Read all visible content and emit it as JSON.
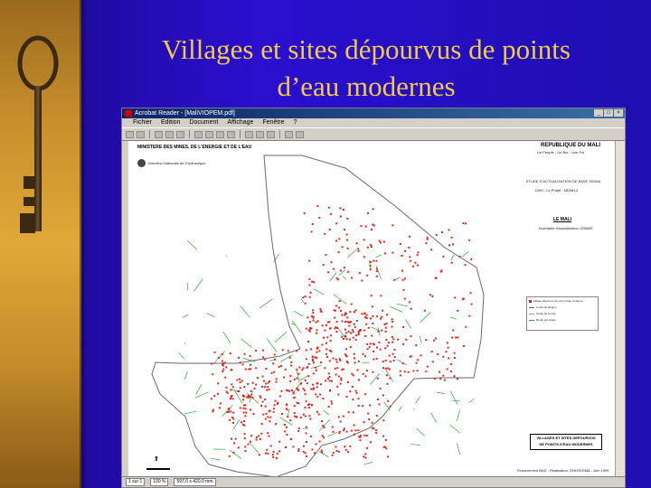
{
  "slide": {
    "title_line1": "Villages et sites dépourvus de points",
    "title_line2": "d’eau modernes"
  },
  "window": {
    "title": "Acrobat Reader - [MaliVIOPEM.pdf]",
    "controls": [
      "_",
      "□",
      "×"
    ]
  },
  "menu": [
    "Fichier",
    "Edition",
    "Document",
    "Affichage",
    "Fenêtre",
    "?"
  ],
  "map": {
    "ministry": "MINISTERE DES MINES, DE L'ENERGIE ET DE L'EAU",
    "direction": "Direction Nationale de l'Hydraulique",
    "republic": "REPUBLIQUE DU MALI",
    "motto": "Un Peuple - Un But - Une Foi",
    "study": "ETUDE D'ACTUALISATION DE BASE SIGMA",
    "project": "DNH - Le Projet - MDNH-2",
    "map_label": "LE MALI",
    "inventory": "Inventaire d'actualisation 1998/99",
    "legend": [
      "Village dépourvu de point d'eau moderne",
      "Limite de Région",
      "Limite de Cercle",
      "Route principale"
    ],
    "box_line1": "VILLAGES ET SITES DEPOURVUS",
    "box_line2": "DE POINTS D'EAU MODERNES",
    "footer": "Financement BAD - Réalisation: DNH/SIGMA - Juin 1999",
    "colors": {
      "villages": "#e8231e",
      "routes": "#2aa83a",
      "borders": "#6a6a6a"
    }
  },
  "status": {
    "page_info": "1 sur 1",
    "zoom": "100 %",
    "size": "597,0 x 420,0 mm"
  }
}
